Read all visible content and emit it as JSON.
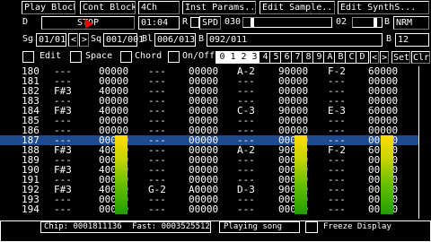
{
  "toolbar": {
    "play_block": "Play Block",
    "cont_block": "Cont Block",
    "channels_4": "4Ch",
    "inst_params": "Inst Params...",
    "edit_sample": "Edit Sample...",
    "edit_synths": "Edit SynthS..."
  },
  "row2": {
    "mode_label": "D",
    "stop_label": "STOP",
    "time": "01:04",
    "r_label": "R",
    "spd_label": "SPD",
    "spd_value": "030",
    "vol_value": "02",
    "b_label": "B",
    "nrm_label": "NRM"
  },
  "row3": {
    "sg_label": "Sg",
    "song_pos": "01/01",
    "prev": "<",
    "next": ">",
    "sq_label": "Sq",
    "seq_pos": "001/001",
    "bl_label": "Bl",
    "block_pos": "006/013",
    "b_label": "B",
    "block_name": "092/011",
    "b2_label": "B",
    "b2_value": "12"
  },
  "row4": {
    "edit_label": "Edit",
    "space_label": "Space",
    "chord_label": "Chord",
    "onoff_label": "On/Off",
    "channels": [
      "0",
      "1",
      "2",
      "3",
      "4",
      "5",
      "6",
      "7",
      "8",
      "9",
      "A",
      "B",
      "C",
      "D"
    ],
    "prev": "<",
    "next": ">",
    "set_label": "Set",
    "clr_label": "Clr"
  },
  "pattern_rows": [
    {
      "n": "180",
      "c": [
        "---",
        "00000",
        "---",
        "00000",
        "A-2",
        "90000",
        "F-2",
        "60000"
      ]
    },
    {
      "n": "181",
      "c": [
        "---",
        "00000",
        "---",
        "00000",
        "---",
        "00000",
        "---",
        "00000"
      ]
    },
    {
      "n": "182",
      "c": [
        "F#3",
        "40000",
        "---",
        "00000",
        "---",
        "00000",
        "---",
        "00000"
      ]
    },
    {
      "n": "183",
      "c": [
        "---",
        "00000",
        "---",
        "00000",
        "---",
        "00000",
        "---",
        "00000"
      ]
    },
    {
      "n": "184",
      "c": [
        "F#3",
        "40000",
        "---",
        "00000",
        "C-3",
        "90000",
        "E-3",
        "60000"
      ]
    },
    {
      "n": "185",
      "c": [
        "---",
        "00000",
        "---",
        "00000",
        "---",
        "00000",
        "---",
        "00000"
      ]
    },
    {
      "n": "186",
      "c": [
        "---",
        "00000",
        "---",
        "00000",
        "---",
        "00000",
        "---",
        "00000"
      ]
    },
    {
      "n": "187",
      "c": [
        "---",
        "00000",
        "---",
        "00000",
        "---",
        "00000",
        "---",
        "00000"
      ]
    },
    {
      "n": "188",
      "c": [
        "F#3",
        "40000",
        "---",
        "00000",
        "A-2",
        "90000",
        "F-2",
        "60000"
      ]
    },
    {
      "n": "189",
      "c": [
        "---",
        "00000",
        "---",
        "00000",
        "---",
        "00000",
        "---",
        "00000"
      ]
    },
    {
      "n": "190",
      "c": [
        "F#3",
        "40000",
        "---",
        "00000",
        "---",
        "00000",
        "---",
        "00000"
      ]
    },
    {
      "n": "191",
      "c": [
        "---",
        "00000",
        "---",
        "00000",
        "---",
        "00000",
        "---",
        "00000"
      ]
    },
    {
      "n": "192",
      "c": [
        "F#3",
        "40000",
        "G-2",
        "A0000",
        "D-3",
        "90000",
        "---",
        "00000"
      ]
    },
    {
      "n": "193",
      "c": [
        "---",
        "00000",
        "---",
        "00000",
        "---",
        "00000",
        "---",
        "00000"
      ]
    },
    {
      "n": "194",
      "c": [
        "---",
        "00000",
        "---",
        "00000",
        "---",
        "00000",
        "---",
        "00000"
      ]
    }
  ],
  "vu_levels": [
    0.8,
    0.0,
    0.8,
    0.8
  ],
  "status": {
    "chip": "Chip: 0001811136",
    "fast": "Fast: 0003525512",
    "playing": "Playing song",
    "freeze": "Freeze Display"
  },
  "colors": {
    "cursor_row": "#1e4b8d",
    "vu_top": "#ffdd00",
    "vu_bottom": "#1fa000"
  }
}
